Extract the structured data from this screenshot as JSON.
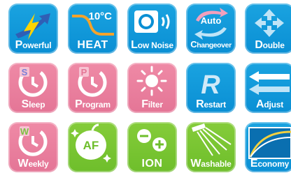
{
  "tiles": {
    "powerful": {
      "cap": "P",
      "rest": "owerful",
      "icon": "lightning-arrow-icon"
    },
    "heat": {
      "label": "HEAT",
      "degree": "10°C",
      "icon": "temperature-curve-icon"
    },
    "lownoise": {
      "cap": "L",
      "rest": "ow Noise",
      "icon": "outdoor-unit-sound-icon"
    },
    "changeover": {
      "cap": "C",
      "rest": "hangeover",
      "auto": "Auto",
      "icon": "cycle-arrows-icon"
    },
    "double": {
      "cap": "D",
      "rest": "ouble",
      "icon": "four-way-arrows-icon"
    },
    "sleep": {
      "cap": "S",
      "rest": "leep",
      "badge": "S",
      "icon": "timer-sleep-icon"
    },
    "program": {
      "cap": "P",
      "rest": "rogram",
      "badge": "P",
      "icon": "timer-program-icon"
    },
    "filter": {
      "cap": "F",
      "rest": "ilter",
      "icon": "sun-icon"
    },
    "restart": {
      "cap": "R",
      "rest": "estart",
      "icon": "restart-r-icon"
    },
    "adjust": {
      "cap": "A",
      "rest": "djust",
      "icon": "adjust-arrows-icon"
    },
    "weekly": {
      "cap": "W",
      "rest": "eekly",
      "badge": "W",
      "icon": "timer-weekly-icon"
    },
    "af": {
      "text": "AF",
      "icon": "apple-af-icon"
    },
    "ion": {
      "label": "ION",
      "icon": "ion-symbols-icon"
    },
    "washable": {
      "cap": "W",
      "rest": "ashable",
      "icon": "shower-icon"
    },
    "economy": {
      "cap": "E",
      "rest": "conomy",
      "icon": "economy-curve-icon"
    }
  },
  "colors": {
    "blue": "#0a8fd4",
    "pink": "#e47596",
    "green": "#6ebe2b"
  }
}
